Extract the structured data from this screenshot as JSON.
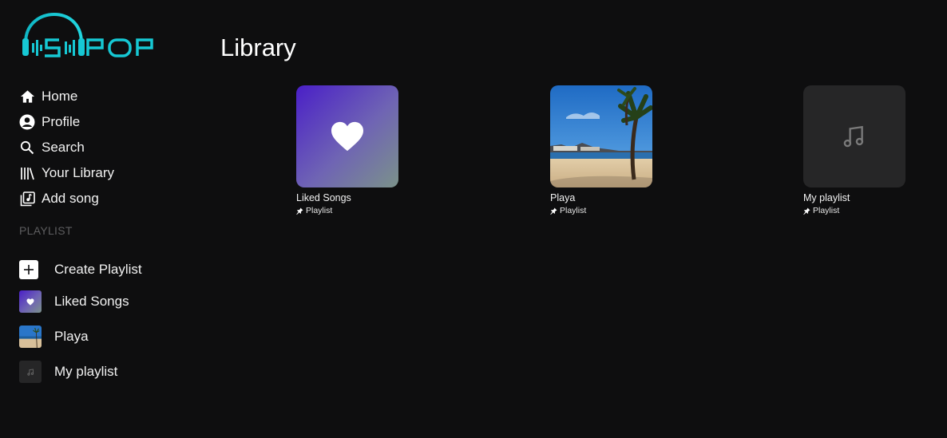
{
  "app": {
    "logo_text": "POP"
  },
  "nav": {
    "items": [
      {
        "label": "Home",
        "icon": "home-icon"
      },
      {
        "label": "Profile",
        "icon": "profile-icon"
      },
      {
        "label": "Search",
        "icon": "search-icon"
      },
      {
        "label": "Your Library",
        "icon": "library-icon"
      },
      {
        "label": "Add song",
        "icon": "add-song-icon"
      }
    ]
  },
  "playlist_section": {
    "label": "PLAYLIST",
    "create_label": "Create Playlist",
    "items": [
      {
        "label": "Liked Songs",
        "thumb": "heart-icon"
      },
      {
        "label": "Playa",
        "thumb": "beach-image"
      },
      {
        "label": "My playlist",
        "thumb": "music-note-icon"
      }
    ]
  },
  "main": {
    "title": "Library",
    "cards": [
      {
        "title": "Liked Songs",
        "subtitle": "Playlist",
        "art": "heart-icon"
      },
      {
        "title": "Playa",
        "subtitle": "Playlist",
        "art": "beach-image"
      },
      {
        "title": "My playlist",
        "subtitle": "Playlist",
        "art": "music-note-icon"
      }
    ]
  },
  "colors": {
    "background": "#0e0e0f",
    "accent_logo": "#16c8d4",
    "section_label": "#5d5d5f",
    "liked_gradient_start": "#4a1fc7",
    "liked_gradient_end": "#7b928a",
    "empty_art": "#262627"
  }
}
